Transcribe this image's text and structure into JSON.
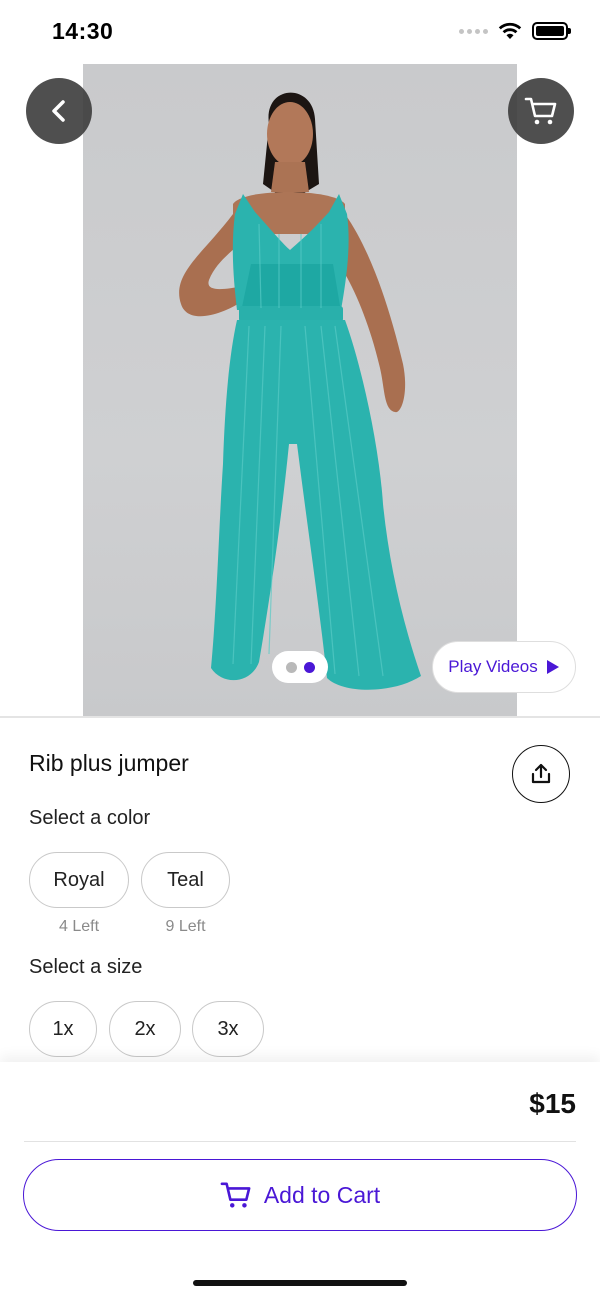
{
  "status_bar": {
    "time": "14:30"
  },
  "product": {
    "title": "Rib plus jumper",
    "price": "$15",
    "image_count": 2,
    "active_image_index": 2
  },
  "hero": {
    "play_videos_label": "Play Videos"
  },
  "color_section": {
    "label": "Select a color",
    "options": [
      {
        "name": "Royal",
        "stock": "4 Left"
      },
      {
        "name": "Teal",
        "stock": "9 Left"
      }
    ]
  },
  "size_section": {
    "label": "Select a size",
    "options": [
      "1x",
      "2x",
      "3x"
    ]
  },
  "cart": {
    "add_label": "Add to Cart"
  },
  "colors": {
    "accent": "#4A17D6",
    "garment": "#2BB3AE",
    "icon_button_bg": "#3C3C3C"
  },
  "icons": {
    "back": "chevron-left-icon",
    "cart": "cart-icon",
    "share": "share-icon",
    "play": "play-icon"
  }
}
